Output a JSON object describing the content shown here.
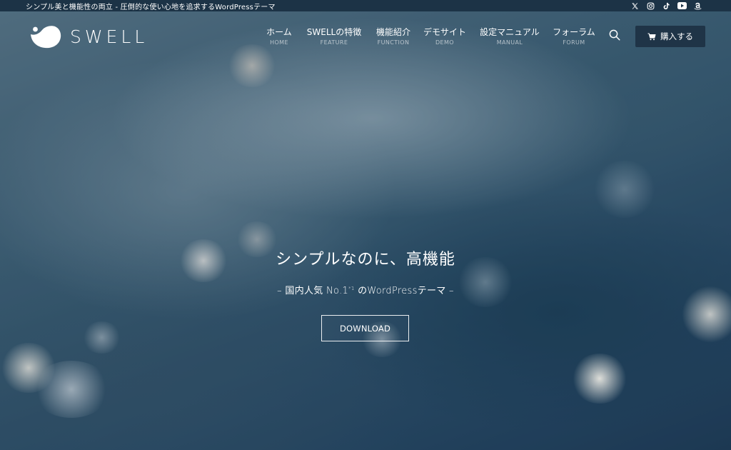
{
  "topbar": {
    "tagline": "シンプル美と機能性の両立 - 圧倒的な使い心地を追求するWordPressテーマ",
    "social": [
      {
        "icon": "x-icon"
      },
      {
        "icon": "instagram-icon"
      },
      {
        "icon": "tiktok-icon"
      },
      {
        "icon": "youtube-icon"
      },
      {
        "icon": "amazon-icon"
      }
    ]
  },
  "header": {
    "logo_text": "SWELL",
    "nav": [
      {
        "label": "ホーム",
        "sub": "HOME"
      },
      {
        "label": "SWELLの特徴",
        "sub": "FEATURE"
      },
      {
        "label": "機能紹介",
        "sub": "FUNCTION"
      },
      {
        "label": "デモサイト",
        "sub": "DEMO"
      },
      {
        "label": "設定マニュアル",
        "sub": "MANUAL"
      },
      {
        "label": "フォーラム",
        "sub": "FORUM"
      }
    ],
    "search_icon": "search-icon",
    "buy_label": "購入する",
    "buy_icon": "cart-icon"
  },
  "hero": {
    "title": "シンプルなのに、高機能",
    "subtitle_prefix": "– 国内人気 No.1",
    "subtitle_sup": "*1",
    "subtitle_suffix": " のWordPressテーマ –",
    "button_label": "DOWNLOAD"
  },
  "colors": {
    "topbar_bg": "#1c3346",
    "buy_button_bg": "#1f3447",
    "text": "#ffffff",
    "hero_base": "#2d5069"
  }
}
